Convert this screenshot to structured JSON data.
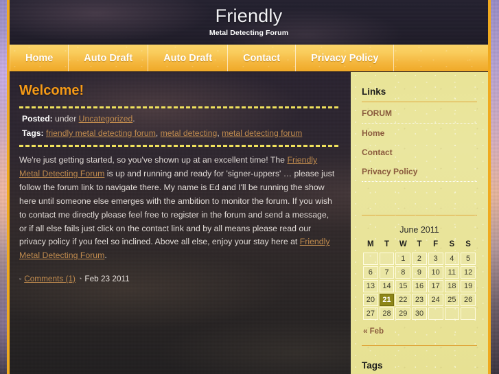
{
  "site": {
    "title": "Friendly",
    "description": "Metal Detecting Forum"
  },
  "nav": {
    "items": [
      {
        "label": "Home"
      },
      {
        "label": "Auto Draft"
      },
      {
        "label": "Auto Draft"
      },
      {
        "label": "Contact"
      },
      {
        "label": "Privacy Policy"
      }
    ]
  },
  "post": {
    "title": "Welcome!",
    "posted_label": "Posted:",
    "posted_under": "under",
    "category": "Uncategorized",
    "period": ".",
    "tags_label": "Tags:",
    "tags": [
      "friendly metal detecting forum",
      "metal detecting",
      "metal detecting forum"
    ],
    "body_part1": "We're just getting started, so you've shown up at an excellent time! The ",
    "body_link1": "Friendly Metal Detecting Forum",
    "body_part2": " is up and running and ready for 'signer-uppers' … please just follow the forum link to navigate there. My name is Ed and I'll be running the show here until someone else emerges with the ambition to monitor the forum. If you wish to contact me directly please feel free to register in the forum and send a message, or if all else fails just click on the contact link and by all means please read our privacy policy if you feel so inclined. Above all else, enjoy your stay here at ",
    "body_link2": "Friendly Metal Detecting Forum",
    "body_part3": ".",
    "comments_link": "Comments (1)",
    "date": "Feb 23 2011",
    "comment_icon": "comment-square-icon",
    "clock_icon": "clock-icon"
  },
  "sidebar": {
    "links": {
      "title": "Links",
      "items": [
        {
          "label": "FORUM"
        },
        {
          "label": "Home"
        },
        {
          "label": "Contact"
        },
        {
          "label": "Privacy Policy"
        }
      ]
    },
    "calendar": {
      "caption": "June 2011",
      "weekdays": [
        "M",
        "T",
        "W",
        "T",
        "F",
        "S",
        "S"
      ],
      "weeks": [
        [
          "",
          "",
          "1",
          "2",
          "3",
          "4",
          "5"
        ],
        [
          "6",
          "7",
          "8",
          "9",
          "10",
          "11",
          "12"
        ],
        [
          "13",
          "14",
          "15",
          "16",
          "17",
          "18",
          "19"
        ],
        [
          "20",
          "21",
          "22",
          "23",
          "24",
          "25",
          "26"
        ],
        [
          "27",
          "28",
          "29",
          "30",
          "",
          "",
          ""
        ]
      ],
      "today": "21",
      "prev_label": "« Feb"
    },
    "tags": {
      "title": "Tags"
    }
  },
  "colors": {
    "accent_orange": "#f0a91e",
    "title_orange": "#f59a17",
    "nav_gradient_top": "#fbd469",
    "nav_gradient_bottom": "#efa928",
    "sidebar_bg": "#e9e497",
    "link_brown": "#8a5a3d",
    "body_link": "#c08b4e",
    "dashed_yellow": "#efe15c",
    "today_bg": "#8d8618"
  }
}
